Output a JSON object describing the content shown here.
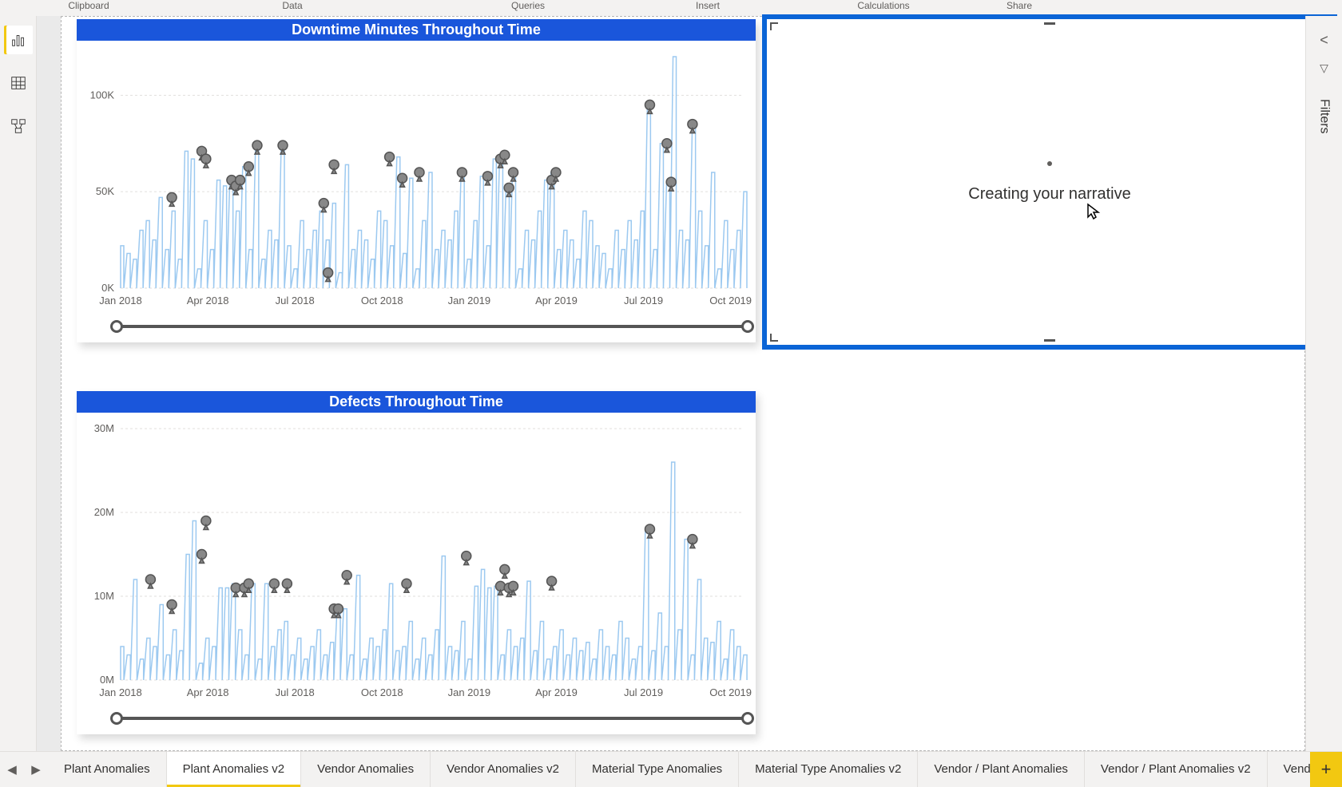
{
  "ribbon_groups": [
    "Clipboard",
    "Data",
    "Queries",
    "Insert",
    "Calculations",
    "Share"
  ],
  "left_rail": [
    {
      "name": "report-view-icon",
      "active": true
    },
    {
      "name": "data-view-icon",
      "active": false
    },
    {
      "name": "model-view-icon",
      "active": false
    }
  ],
  "narrative": {
    "status": "Creating your narrative"
  },
  "right_rail": {
    "collapse": "<",
    "filters_label": "Filters",
    "filter_glyph": "▽"
  },
  "tabs": [
    "Plant Anomalies",
    "Plant Anomalies v2",
    "Vendor Anomalies",
    "Vendor Anomalies v2",
    "Material Type Anomalies",
    "Material Type Anomalies v2",
    "Vendor / Plant Anomalies",
    "Vendor / Plant Anomalies v2",
    "Vendor / Plant Ano"
  ],
  "active_tab_index": 1,
  "tab_nav": {
    "prev": "◀",
    "next": "▶",
    "add": "+"
  },
  "chart_data": [
    {
      "id": "downtime",
      "type": "line",
      "title": "Downtime Minutes Throughout Time",
      "xlabel": "",
      "ylabel": "",
      "x_ticks": [
        "Jan 2018",
        "Apr 2018",
        "Jul 2018",
        "Oct 2018",
        "Jan 2019",
        "Apr 2019",
        "Jul 2019",
        "Oct 2019"
      ],
      "y_ticks": [
        {
          "v": 0,
          "l": "0K"
        },
        {
          "v": 50000,
          "l": "50K"
        },
        {
          "v": 100000,
          "l": "100K"
        }
      ],
      "ylim": [
        0,
        120000
      ],
      "x_domain": [
        0,
        730
      ],
      "markers": [
        {
          "x": 60,
          "y": 47000
        },
        {
          "x": 95,
          "y": 71000
        },
        {
          "x": 100,
          "y": 67000
        },
        {
          "x": 130,
          "y": 56000
        },
        {
          "x": 135,
          "y": 53000
        },
        {
          "x": 140,
          "y": 56000
        },
        {
          "x": 150,
          "y": 63000
        },
        {
          "x": 160,
          "y": 74000
        },
        {
          "x": 190,
          "y": 74000
        },
        {
          "x": 238,
          "y": 44000
        },
        {
          "x": 243,
          "y": 8000
        },
        {
          "x": 250,
          "y": 64000
        },
        {
          "x": 315,
          "y": 68000
        },
        {
          "x": 330,
          "y": 57000
        },
        {
          "x": 350,
          "y": 60000
        },
        {
          "x": 400,
          "y": 60000
        },
        {
          "x": 430,
          "y": 58000
        },
        {
          "x": 445,
          "y": 67000
        },
        {
          "x": 450,
          "y": 69000
        },
        {
          "x": 455,
          "y": 52000
        },
        {
          "x": 460,
          "y": 60000
        },
        {
          "x": 505,
          "y": 56000
        },
        {
          "x": 510,
          "y": 60000
        },
        {
          "x": 620,
          "y": 95000
        },
        {
          "x": 640,
          "y": 75000
        },
        {
          "x": 645,
          "y": 55000
        },
        {
          "x": 670,
          "y": 85000
        }
      ],
      "series": [
        {
          "name": "Downtime Minutes",
          "values": [
            22000,
            18000,
            15000,
            30000,
            35000,
            25000,
            47000,
            20000,
            40000,
            15000,
            71000,
            67000,
            10000,
            35000,
            20000,
            56000,
            53000,
            56000,
            40000,
            63000,
            20000,
            74000,
            15000,
            30000,
            25000,
            74000,
            22000,
            10000,
            35000,
            20000,
            30000,
            40000,
            25000,
            44000,
            8000,
            64000,
            20000,
            30000,
            25000,
            15000,
            40000,
            35000,
            22000,
            68000,
            18000,
            57000,
            10000,
            35000,
            60000,
            20000,
            30000,
            25000,
            40000,
            60000,
            15000,
            35000,
            58000,
            22000,
            67000,
            69000,
            52000,
            60000,
            10000,
            30000,
            25000,
            40000,
            56000,
            60000,
            20000,
            30000,
            25000,
            15000,
            40000,
            35000,
            22000,
            18000,
            10000,
            30000,
            20000,
            35000,
            25000,
            40000,
            95000,
            20000,
            75000,
            55000,
            120000,
            30000,
            25000,
            85000,
            40000,
            22000,
            60000,
            10000,
            35000,
            20000,
            30000,
            50000
          ]
        }
      ]
    },
    {
      "id": "defects",
      "type": "line",
      "title": "Defects Throughout Time",
      "xlabel": "",
      "ylabel": "",
      "x_ticks": [
        "Jan 2018",
        "Apr 2018",
        "Jul 2018",
        "Oct 2018",
        "Jan 2019",
        "Apr 2019",
        "Jul 2019",
        "Oct 2019"
      ],
      "y_ticks": [
        {
          "v": 0,
          "l": "0M"
        },
        {
          "v": 10000000,
          "l": "10M"
        },
        {
          "v": 20000000,
          "l": "20M"
        },
        {
          "v": 30000000,
          "l": "30M"
        }
      ],
      "ylim": [
        0,
        30000000
      ],
      "x_domain": [
        0,
        730
      ],
      "markers": [
        {
          "x": 35,
          "y": 12000000
        },
        {
          "x": 60,
          "y": 9000000
        },
        {
          "x": 95,
          "y": 15000000
        },
        {
          "x": 100,
          "y": 19000000
        },
        {
          "x": 135,
          "y": 11000000
        },
        {
          "x": 145,
          "y": 11000000
        },
        {
          "x": 150,
          "y": 11500000
        },
        {
          "x": 180,
          "y": 11500000
        },
        {
          "x": 195,
          "y": 11500000
        },
        {
          "x": 250,
          "y": 8500000
        },
        {
          "x": 255,
          "y": 8500000
        },
        {
          "x": 265,
          "y": 12500000
        },
        {
          "x": 335,
          "y": 11500000
        },
        {
          "x": 405,
          "y": 14800000
        },
        {
          "x": 445,
          "y": 11200000
        },
        {
          "x": 450,
          "y": 13200000
        },
        {
          "x": 455,
          "y": 11000000
        },
        {
          "x": 460,
          "y": 11200000
        },
        {
          "x": 505,
          "y": 11800000
        },
        {
          "x": 620,
          "y": 18000000
        },
        {
          "x": 670,
          "y": 16800000
        }
      ],
      "series": [
        {
          "name": "Defects",
          "values": [
            4000000,
            3000000,
            12000000,
            2500000,
            5000000,
            4000000,
            9000000,
            3000000,
            6000000,
            3500000,
            15000000,
            19000000,
            2000000,
            5000000,
            4000000,
            11000000,
            11000000,
            11500000,
            6000000,
            3000000,
            11500000,
            2500000,
            11500000,
            4000000,
            6000000,
            7000000,
            3000000,
            5000000,
            2500000,
            4000000,
            6000000,
            3000000,
            4500000,
            8500000,
            8500000,
            3000000,
            12500000,
            2500000,
            5000000,
            4000000,
            6000000,
            11500000,
            3500000,
            4000000,
            7000000,
            2500000,
            5000000,
            3000000,
            6000000,
            14800000,
            4000000,
            3500000,
            7000000,
            2500000,
            11200000,
            13200000,
            11000000,
            11200000,
            3000000,
            6000000,
            4000000,
            5000000,
            11800000,
            3500000,
            7000000,
            2500000,
            4000000,
            6000000,
            3000000,
            5000000,
            3500000,
            4500000,
            2500000,
            6000000,
            4000000,
            3000000,
            7000000,
            5000000,
            2500000,
            4000000,
            18000000,
            3500000,
            8000000,
            4000000,
            26000000,
            6000000,
            16800000,
            3000000,
            12000000,
            5000000,
            4500000,
            7000000,
            2500000,
            6000000,
            4000000,
            3000000
          ]
        }
      ]
    }
  ]
}
